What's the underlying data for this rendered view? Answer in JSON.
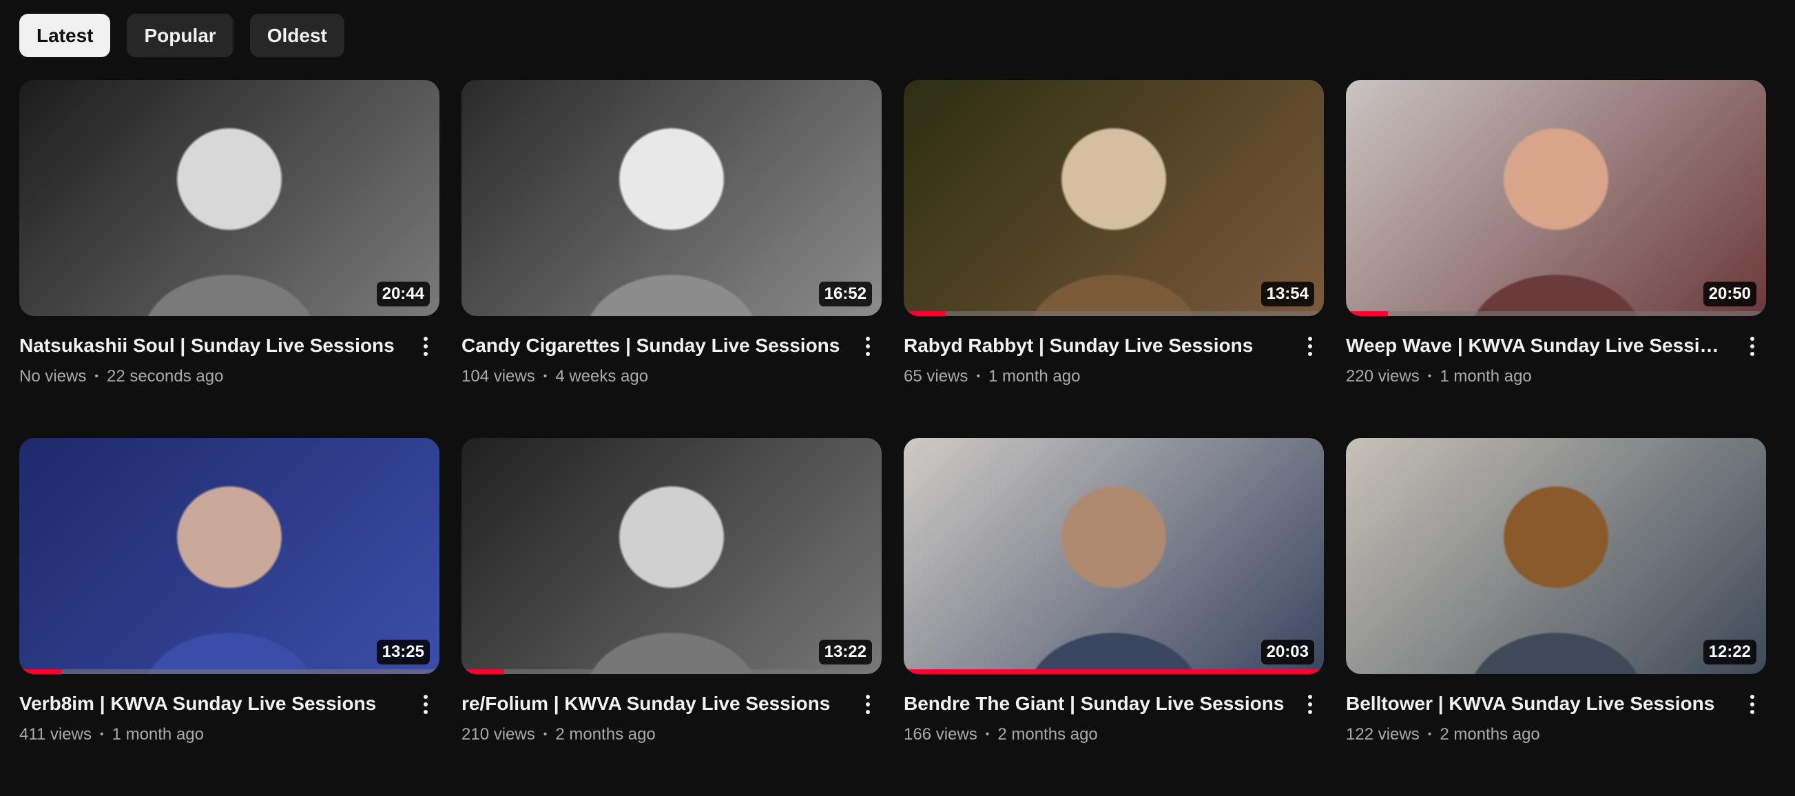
{
  "filters": [
    {
      "label": "Latest",
      "active": true
    },
    {
      "label": "Popular",
      "active": false
    },
    {
      "label": "Oldest",
      "active": false
    }
  ],
  "videos": [
    {
      "title": "Natsukashii Soul | Sunday Live Sessions",
      "views": "No views",
      "age": "22 seconds ago",
      "duration": "20:44",
      "progress": 0,
      "thumb_colors": [
        "#1c1c1c",
        "#7a7a7a",
        "#d8d8d8"
      ]
    },
    {
      "title": "Candy Cigarettes | Sunday Live Sessions",
      "views": "104 views",
      "age": "4 weeks ago",
      "duration": "16:52",
      "progress": 0,
      "thumb_colors": [
        "#2a2a2a",
        "#8c8c8c",
        "#e8e8e8"
      ]
    },
    {
      "title": "Rabyd Rabbyt | Sunday Live Sessions",
      "views": "65 views",
      "age": "1 month ago",
      "duration": "13:54",
      "progress": 0.1,
      "thumb_colors": [
        "#2c2e12",
        "#7b5a3a",
        "#d4c0a0"
      ]
    },
    {
      "title": "Weep Wave | KWVA Sunday Live Sessions",
      "views": "220 views",
      "age": "1 month ago",
      "duration": "20:50",
      "progress": 0.1,
      "thumb_colors": [
        "#c9c4c2",
        "#6b3a3a",
        "#d8a48a"
      ]
    },
    {
      "title": "Verb8im | KWVA Sunday Live Sessions",
      "views": "411 views",
      "age": "1 month ago",
      "duration": "13:25",
      "progress": 0.1,
      "thumb_colors": [
        "#1f2a6a",
        "#3b4da8",
        "#c9a899"
      ]
    },
    {
      "title": "re/Folium | KWVA Sunday Live Sessions",
      "views": "210 views",
      "age": "2 months ago",
      "duration": "13:22",
      "progress": 0.1,
      "thumb_colors": [
        "#202020",
        "#777777",
        "#d0d0d0"
      ]
    },
    {
      "title": "Bendre The Giant | Sunday Live Sessions",
      "views": "166 views",
      "age": "2 months ago",
      "duration": "20:03",
      "progress": 1.0,
      "thumb_colors": [
        "#cfcbc6",
        "#3a4560",
        "#b08a70"
      ]
    },
    {
      "title": "Belltower | KWVA Sunday Live Sessions",
      "views": "122 views",
      "age": "2 months ago",
      "duration": "12:22",
      "progress": 0,
      "thumb_colors": [
        "#c8c2b8",
        "#3e4a58",
        "#8a5a2a"
      ]
    }
  ]
}
